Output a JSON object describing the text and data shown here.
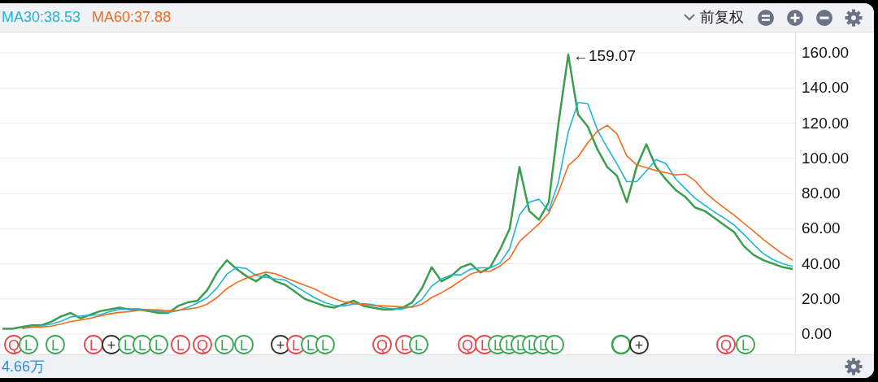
{
  "header": {
    "adjustment": "前复权"
  },
  "chart_data": {
    "type": "line",
    "grid": true,
    "series": [
      {
        "color": "#3a9e4f",
        "values": [
          3,
          3,
          4,
          5,
          5,
          7,
          10,
          12,
          9,
          11,
          13,
          14,
          15,
          14,
          14,
          13,
          12,
          12,
          16,
          18,
          19,
          25,
          35,
          42,
          37,
          33,
          30,
          34,
          30,
          28,
          24,
          20,
          18,
          16,
          15,
          17,
          19,
          16,
          15,
          14,
          14,
          15,
          18,
          26,
          38,
          30,
          33,
          38,
          40,
          35,
          38,
          48,
          60,
          95,
          70,
          65,
          75,
          120,
          159,
          125,
          118,
          105,
          95,
          90,
          75,
          95,
          108,
          95,
          88,
          82,
          78,
          72,
          70,
          66,
          62,
          58,
          50,
          45,
          42,
          40,
          38,
          37
        ]
      },
      {
        "name": "MA30:38.53",
        "color": "#1fb5d6",
        "values": [
          null,
          null,
          3.3,
          4,
          4.7,
          5.7,
          7.3,
          9.7,
          10.3,
          10.7,
          11,
          12.7,
          14,
          14.3,
          14.3,
          13.7,
          13,
          12.3,
          13.3,
          15.3,
          17.7,
          20.7,
          26.3,
          34,
          38,
          37.3,
          33.3,
          32.3,
          31.3,
          30.7,
          27.3,
          24,
          20.7,
          18,
          16.3,
          16,
          17,
          17.3,
          16.7,
          15,
          14.3,
          14.3,
          15.7,
          19.7,
          27.3,
          31.3,
          33.7,
          33.7,
          37,
          37.7,
          37.7,
          40.3,
          48.7,
          67.7,
          75,
          76.7,
          70,
          86.7,
          115,
          131.7,
          131,
          116,
          106,
          96.7,
          86.7,
          86.7,
          92.7,
          99.3,
          97,
          88.3,
          82.7,
          77.3,
          73.3,
          69.3,
          66,
          62,
          56.7,
          51,
          45.7,
          42.3,
          40,
          38.5
        ]
      },
      {
        "name": "MA60:37.88",
        "color": "#f26b1d",
        "values": [
          null,
          null,
          3.3,
          3.8,
          4,
          4.5,
          5.7,
          7.2,
          8,
          9,
          10.3,
          11.5,
          12.3,
          12.7,
          13.5,
          13.8,
          13.7,
          13.3,
          13.5,
          14.2,
          15,
          17,
          20.8,
          25.8,
          29.3,
          31.8,
          33.7,
          35.2,
          34.3,
          32,
          29.8,
          27.7,
          25.7,
          22.7,
          20.2,
          18.3,
          17.5,
          16.8,
          16.3,
          16,
          15.8,
          15.5,
          15.3,
          17,
          20.8,
          23.5,
          26.7,
          30.5,
          34.2,
          35.7,
          35.7,
          38.7,
          43.2,
          52.7,
          57.7,
          62.7,
          68.8,
          80.8,
          95.8,
          100.8,
          108.8,
          115.5,
          118.8,
          113.8,
          101.3,
          96.3,
          94.7,
          93,
          91.8,
          90.5,
          91,
          87.2,
          80.8,
          76,
          71.7,
          67.7,
          63,
          58.5,
          53.8,
          49.5,
          45.5,
          42
        ]
      }
    ],
    "ylim": [
      0,
      160
    ],
    "yticks": [
      {
        "value": 160,
        "label": "160.00"
      },
      {
        "value": 140,
        "label": "140.00"
      },
      {
        "value": 120,
        "label": "120.00"
      },
      {
        "value": 100,
        "label": "100.00"
      },
      {
        "value": 80,
        "label": "80.00"
      },
      {
        "value": 60,
        "label": "60.00"
      },
      {
        "value": 40,
        "label": "40.00"
      },
      {
        "value": 20,
        "label": "20.00"
      },
      {
        "value": 0,
        "label": "0.00"
      }
    ],
    "annotations": [
      "←159.07"
    ]
  },
  "events": [
    {
      "label": "Q",
      "color": "#e5484d"
    },
    {
      "label": "L",
      "color": "#3aa655"
    },
    {
      "label": "L",
      "color": "#3aa655"
    },
    {
      "label": "L",
      "color": "#e5484d"
    },
    {
      "label": "+",
      "color": "#333333"
    },
    {
      "label": "L",
      "color": "#3aa655"
    },
    {
      "label": "L",
      "color": "#3aa655"
    },
    {
      "label": "L",
      "color": "#3aa655"
    },
    {
      "label": "L",
      "color": "#e5484d"
    },
    {
      "label": "Q",
      "color": "#e5484d"
    },
    {
      "label": "L",
      "color": "#3aa655"
    },
    {
      "label": "L",
      "color": "#3aa655"
    },
    {
      "label": "+",
      "color": "#333333"
    },
    {
      "label": "L",
      "color": "#e5484d"
    },
    {
      "label": "L",
      "color": "#3aa655"
    },
    {
      "label": "L",
      "color": "#3aa655"
    },
    {
      "label": "Q",
      "color": "#e5484d"
    },
    {
      "label": "L",
      "color": "#e5484d"
    },
    {
      "label": "L",
      "color": "#3aa655"
    },
    {
      "label": "Q",
      "color": "#e5484d"
    },
    {
      "label": "L",
      "color": "#e5484d"
    },
    {
      "label": "L",
      "color": "#3aa655"
    },
    {
      "label": "L",
      "color": "#3aa655"
    },
    {
      "label": "L",
      "color": "#3aa655"
    },
    {
      "label": "L",
      "color": "#3aa655"
    },
    {
      "label": "L",
      "color": "#3aa655"
    },
    {
      "label": "L",
      "color": "#3aa655"
    },
    {
      "color": "#3aa655"
    },
    {
      "label": "+",
      "color": "#333333"
    },
    {
      "label": "Q",
      "color": "#e5484d"
    },
    {
      "label": "L",
      "color": "#3aa655"
    }
  ],
  "footer": {
    "volume": "4.66万"
  }
}
